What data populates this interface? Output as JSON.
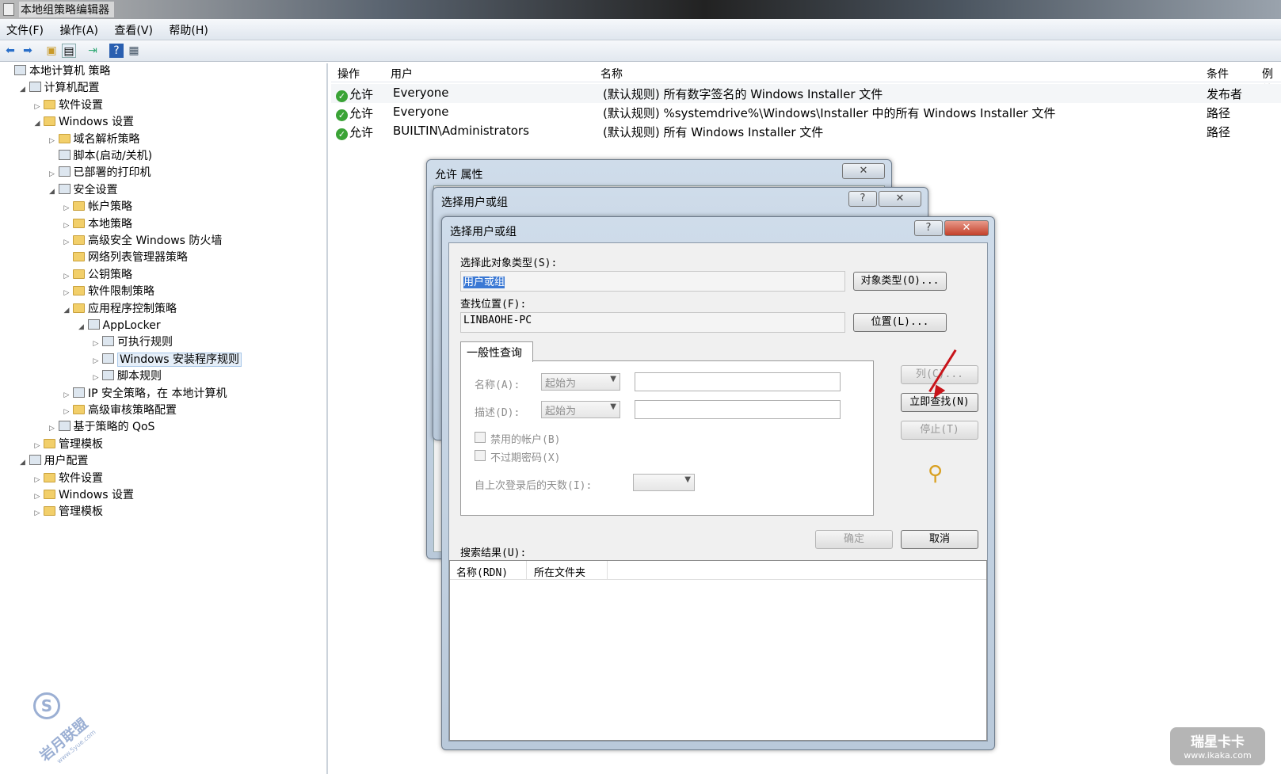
{
  "window": {
    "title": "本地组策略编辑器"
  },
  "menu": [
    "文件(F)",
    "操作(A)",
    "查看(V)",
    "帮助(H)"
  ],
  "toolbar_icons": [
    "back-icon",
    "forward-icon",
    "up-folder-icon",
    "show-tree-icon",
    "export-icon",
    "help-icon",
    "properties-icon"
  ],
  "tree": [
    {
      "label": "本地计算机 策略",
      "level": 0,
      "exp": "",
      "icon": "policy"
    },
    {
      "label": "计算机配置",
      "level": 1,
      "exp": "◢",
      "icon": "computer"
    },
    {
      "label": "软件设置",
      "level": 2,
      "exp": "▷",
      "icon": "folder"
    },
    {
      "label": "Windows 设置",
      "level": 2,
      "exp": "◢",
      "icon": "folder"
    },
    {
      "label": "域名解析策略",
      "level": 3,
      "exp": "▷",
      "icon": "folder"
    },
    {
      "label": "脚本(启动/关机)",
      "level": 3,
      "exp": "",
      "icon": "script"
    },
    {
      "label": "已部署的打印机",
      "level": 3,
      "exp": "▷",
      "icon": "printer"
    },
    {
      "label": "安全设置",
      "level": 3,
      "exp": "◢",
      "icon": "security"
    },
    {
      "label": "帐户策略",
      "level": 4,
      "exp": "▷",
      "icon": "folder"
    },
    {
      "label": "本地策略",
      "level": 4,
      "exp": "▷",
      "icon": "folder"
    },
    {
      "label": "高级安全 Windows 防火墙",
      "level": 4,
      "exp": "▷",
      "icon": "folder"
    },
    {
      "label": "网络列表管理器策略",
      "level": 4,
      "exp": "",
      "icon": "folder"
    },
    {
      "label": "公钥策略",
      "level": 4,
      "exp": "▷",
      "icon": "folder"
    },
    {
      "label": "软件限制策略",
      "level": 4,
      "exp": "▷",
      "icon": "folder"
    },
    {
      "label": "应用程序控制策略",
      "level": 4,
      "exp": "◢",
      "icon": "folder"
    },
    {
      "label": "AppLocker",
      "level": 5,
      "exp": "◢",
      "icon": "applocker"
    },
    {
      "label": "可执行规则",
      "level": 6,
      "exp": "▷",
      "icon": "rule"
    },
    {
      "label": "Windows 安装程序规则",
      "level": 6,
      "exp": "▷",
      "icon": "rule",
      "selected": true
    },
    {
      "label": "脚本规则",
      "level": 6,
      "exp": "▷",
      "icon": "rule"
    },
    {
      "label": "IP 安全策略，在 本地计算机",
      "level": 4,
      "exp": "▷",
      "icon": "ipsec"
    },
    {
      "label": "高级审核策略配置",
      "level": 4,
      "exp": "▷",
      "icon": "folder"
    },
    {
      "label": "基于策略的 QoS",
      "level": 3,
      "exp": "▷",
      "icon": "qos"
    },
    {
      "label": "管理模板",
      "level": 2,
      "exp": "▷",
      "icon": "folder"
    },
    {
      "label": "用户配置",
      "level": 1,
      "exp": "◢",
      "icon": "user"
    },
    {
      "label": "软件设置",
      "level": 2,
      "exp": "▷",
      "icon": "folder"
    },
    {
      "label": "Windows 设置",
      "level": 2,
      "exp": "▷",
      "icon": "folder"
    },
    {
      "label": "管理模板",
      "level": 2,
      "exp": "▷",
      "icon": "folder"
    }
  ],
  "list": {
    "headers": [
      "操作",
      "用户",
      "名称",
      "条件",
      "例外"
    ],
    "rows": [
      {
        "action": "允许",
        "user": "Everyone",
        "name": "(默认规则) 所有数字签名的 Windows Installer 文件",
        "condition": "发布者"
      },
      {
        "action": "允许",
        "user": "Everyone",
        "name": "(默认规则) %systemdrive%\\Windows\\Installer 中的所有 Windows Installer 文件",
        "condition": "路径"
      },
      {
        "action": "允许",
        "user": "BUILTIN\\Administrators",
        "name": "(默认规则) 所有 Windows Installer 文件",
        "condition": "路径"
      }
    ]
  },
  "dlg_props": {
    "title": "允许 属性"
  },
  "dlg_select_back": {
    "title": "选择用户或组"
  },
  "dlg_select": {
    "title": "选择用户或组",
    "object_type_label": "选择此对象类型(S):",
    "object_type_value": "用户或组",
    "object_type_button": "对象类型(O)...",
    "location_label": "查找位置(F):",
    "location_value": "LINBAOHE-PC",
    "location_button": "位置(L)...",
    "tab": "一般性查询",
    "name_label": "名称(A):",
    "name_combo": "起始为",
    "desc_label": "描述(D):",
    "desc_combo": "起始为",
    "disabled_accounts": "禁用的帐户(B)",
    "no_expire": "不过期密码(X)",
    "days_label": "自上次登录后的天数(I):",
    "columns_button": "列(C)...",
    "find_now_button": "立即查找(N)",
    "stop_button": "停止(T)",
    "ok_button": "确定",
    "cancel_button": "取消",
    "results_label": "搜索结果(U):",
    "results_headers": [
      "名称(RDN)",
      "所在文件夹"
    ]
  },
  "watermark_left": {
    "line1": "岩月联盟",
    "line2": "www.5yue.com"
  },
  "watermark_right": {
    "line1": "瑞星卡卡",
    "line2": "www.ikaka.com"
  }
}
